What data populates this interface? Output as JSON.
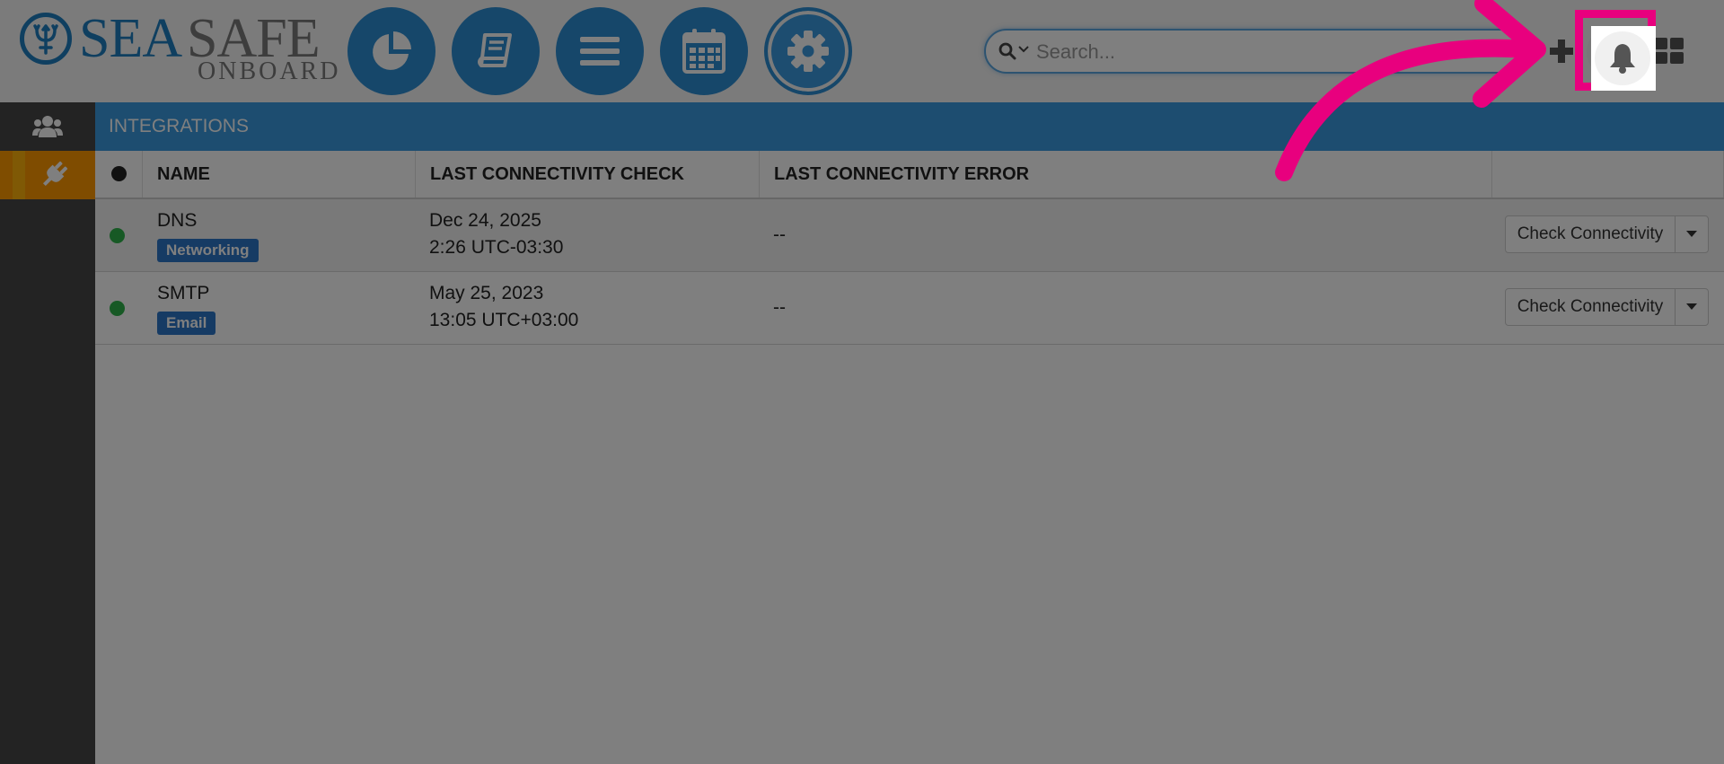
{
  "header": {
    "logo": {
      "word_primary": "SEA",
      "word_secondary": "SAFE",
      "word_sub": "ONBOARD"
    },
    "nav_buttons": [
      {
        "icon": "pie-chart-icon"
      },
      {
        "icon": "book-icon"
      },
      {
        "icon": "list-icon"
      },
      {
        "icon": "calendar-icon"
      },
      {
        "icon": "gear-icon"
      }
    ],
    "search": {
      "placeholder": "Search..."
    },
    "actions": {
      "add_icon": "plus-icon",
      "notifications_icon": "bell-icon",
      "apps_icon": "grid-icon"
    }
  },
  "sidebar": {
    "items": [
      {
        "icon": "users-icon",
        "active": false
      },
      {
        "icon": "plug-icon",
        "active": true
      }
    ]
  },
  "section": {
    "title": "INTEGRATIONS"
  },
  "table": {
    "columns": [
      "NAME",
      "LAST CONNECTIVITY CHECK",
      "LAST CONNECTIVITY ERROR"
    ],
    "rows": [
      {
        "name": "DNS",
        "tag": "Networking",
        "check_date": "Dec 24, 2025",
        "check_time": "2:26 UTC-03:30",
        "error": "--",
        "action": "Check Connectivity"
      },
      {
        "name": "SMTP",
        "tag": "Email",
        "check_date": "May 25, 2023",
        "check_time": "13:05 UTC+03:00",
        "error": "--",
        "action": "Check Connectivity"
      }
    ]
  },
  "colors": {
    "brand_blue": "#2d8ed4",
    "section_blue": "#3a9ae0",
    "sidebar_active": "#ff9a00",
    "status_ok": "#2fb34a",
    "tag_blue": "#2d76c8",
    "highlight_pink": "#e8007e"
  }
}
